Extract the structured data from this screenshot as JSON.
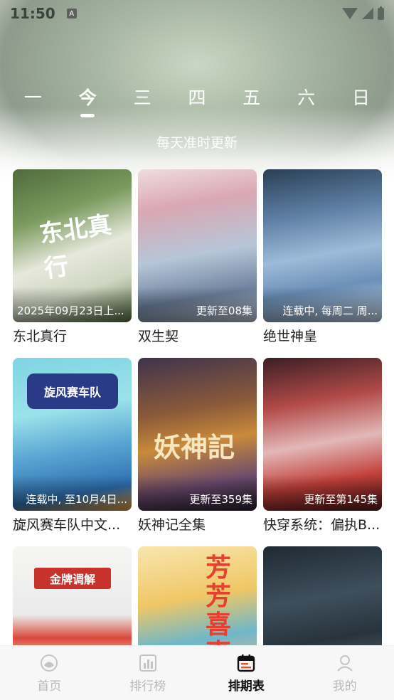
{
  "status_bar": {
    "time": "11:50",
    "app_badge": "A"
  },
  "days": {
    "items": [
      "一",
      "今",
      "三",
      "四",
      "五",
      "六",
      "日"
    ],
    "active_index": 1
  },
  "subtitle": "每天准时更新",
  "cards": [
    {
      "title": "东北真行",
      "status": "2025年09月23日上...",
      "status_align": "left",
      "poster_text": "东北真行"
    },
    {
      "title": "双生契",
      "status": "更新至08集",
      "status_align": "right",
      "poster_text": ""
    },
    {
      "title": "绝世神皇",
      "status": "连载中, 每周二 周...",
      "status_align": "right",
      "poster_text": ""
    },
    {
      "title": "旋风赛车队中文...",
      "status": "连载中, 至10月4日...",
      "status_align": "right",
      "poster_text": "旋风赛车队"
    },
    {
      "title": "妖神记全集",
      "status": "更新至359集",
      "status_align": "right",
      "poster_text": "妖神記"
    },
    {
      "title": "快穿系统：偏执B...",
      "status": "更新至第145集",
      "status_align": "right",
      "poster_text": ""
    },
    {
      "title": "",
      "status": "",
      "status_align": "right",
      "poster_text": "金牌调解"
    },
    {
      "title": "",
      "status": "",
      "status_align": "right",
      "poster_text": "芳芳喜事"
    },
    {
      "title": "",
      "status": "",
      "status_align": "right",
      "poster_text": ""
    }
  ],
  "tabbar": {
    "items": [
      {
        "label": "首页",
        "icon": "home-icon"
      },
      {
        "label": "排行榜",
        "icon": "ranking-icon"
      },
      {
        "label": "排期表",
        "icon": "schedule-icon"
      },
      {
        "label": "我的",
        "icon": "profile-icon"
      }
    ],
    "active_index": 2,
    "active_color": "#111111",
    "inactive_color": "#b8b8b8"
  }
}
